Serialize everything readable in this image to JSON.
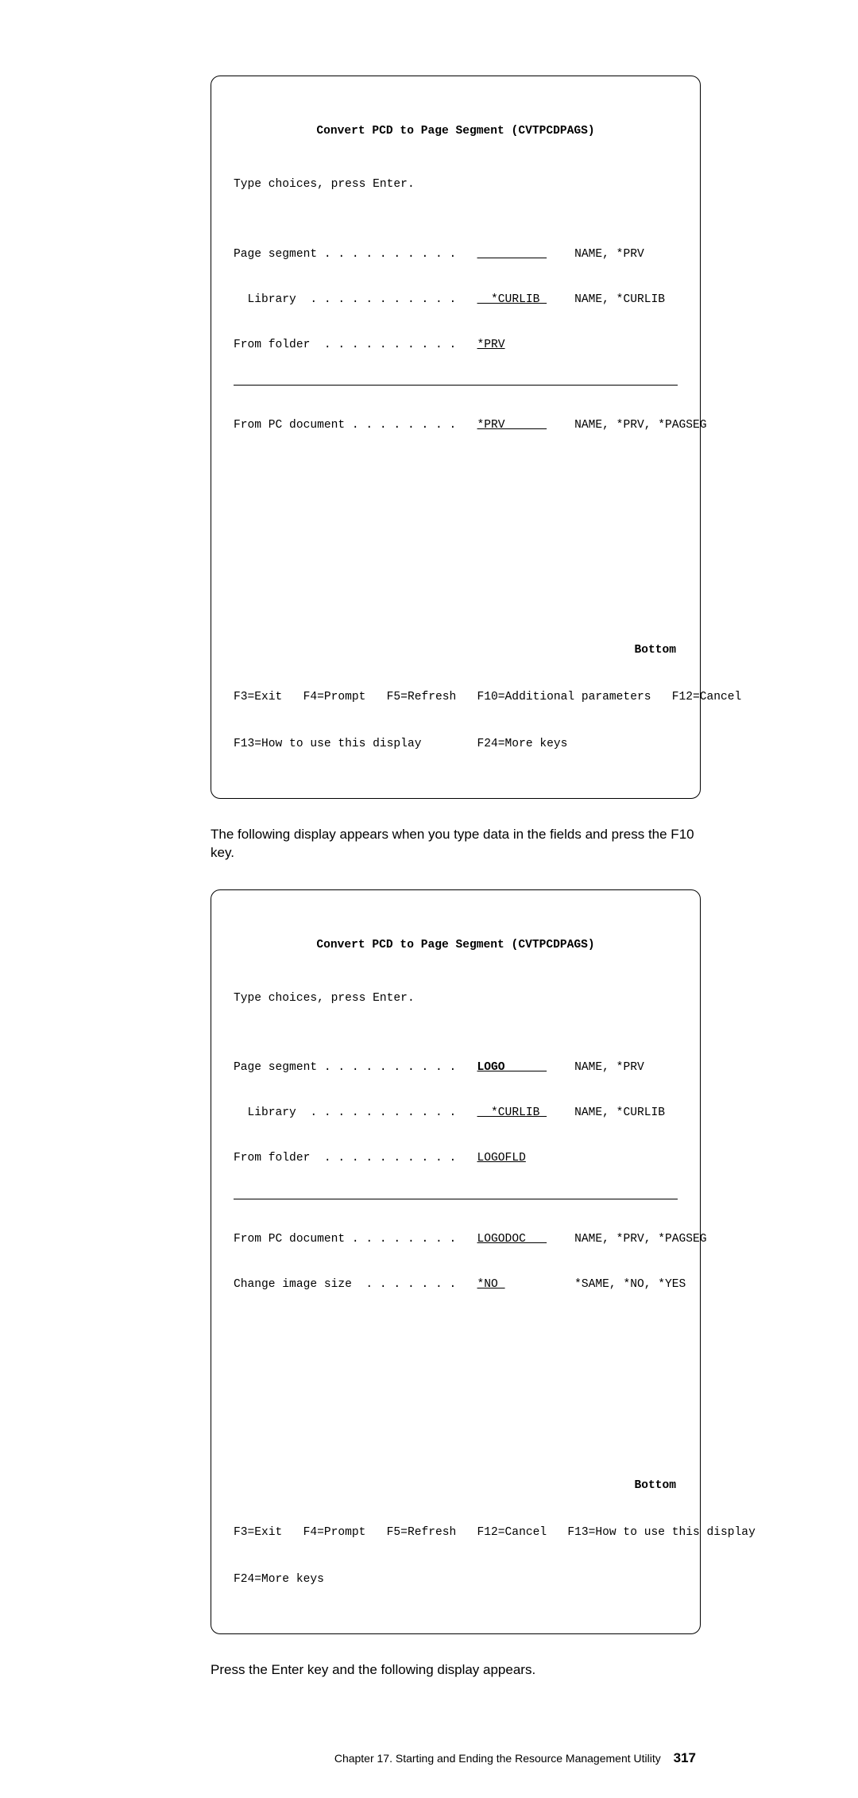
{
  "screen1": {
    "title": "Convert PCD to Page Segment (CVTPCDPAGS)",
    "instruction": "Type choices, press Enter.",
    "line_pageseg_label": "Page segment . . . . . . . . . .",
    "line_pageseg_val": "          ",
    "line_pageseg_hint": "NAME, *PRV",
    "line_lib_label": "  Library  . . . . . . . . . . .",
    "line_lib_val": "  *CURLIB ",
    "line_lib_hint": "NAME, *CURLIB",
    "line_folder_label": "From folder  . . . . . . . . . .",
    "line_folder_val": "*PRV",
    "line_pcdoc_label": "From PC document . . . . . . . .",
    "line_pcdoc_val": "*PRV      ",
    "line_pcdoc_hint": "NAME, *PRV, *PAGSEG",
    "bottom": "Bottom",
    "fkeys1": "F3=Exit   F4=Prompt   F5=Refresh   F10=Additional parameters   F12=Cancel",
    "fkeys2": "F13=How to use this display        F24=More keys"
  },
  "para1": "The following display appears when you type data in the fields and press the F10 key.",
  "screen2": {
    "title": "Convert PCD to Page Segment (CVTPCDPAGS)",
    "instruction": "Type choices, press Enter.",
    "line_pageseg_label": "Page segment . . . . . . . . . .",
    "line_pageseg_val": "LOGO      ",
    "line_pageseg_hint": "NAME, *PRV",
    "line_lib_label": "  Library  . . . . . . . . . . .",
    "line_lib_val": "  *CURLIB ",
    "line_lib_hint": "NAME, *CURLIB",
    "line_folder_label": "From folder  . . . . . . . . . .",
    "line_folder_val": "LOGOFLD",
    "line_pcdoc_label": "From PC document . . . . . . . .",
    "line_pcdoc_val": "LOGODOC   ",
    "line_pcdoc_hint": "NAME, *PRV, *PAGSEG",
    "line_chgimg_label": "Change image size  . . . . . . .",
    "line_chgimg_val": "*NO ",
    "line_chgimg_hint": "*SAME, *NO, *YES",
    "bottom": "Bottom",
    "fkeys1": "F3=Exit   F4=Prompt   F5=Refresh   F12=Cancel   F13=How to use this display",
    "fkeys2": "F24=More keys"
  },
  "para2": "Press the Enter key and the following display appears.",
  "footer_text": "Chapter 17.  Starting and Ending the Resource Management Utility",
  "footer_page": "317"
}
